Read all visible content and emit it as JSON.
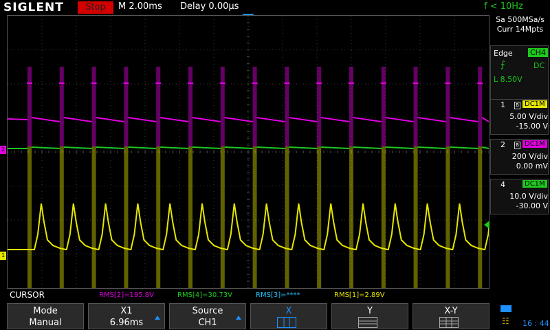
{
  "header": {
    "brand": "SIGLENT",
    "run_state": "Stop",
    "timebase": "M 2.00ms",
    "delay": "Delay 0.00μs",
    "frequency": "f < 10Hz"
  },
  "acquisition": {
    "sample_rate": "Sa 500MSa/s",
    "memory": "Curr 14Mpts"
  },
  "trigger": {
    "type": "Edge",
    "source": "CH4",
    "slope_icon": "rising-edge-icon",
    "coupling": "DC",
    "level": "L  8.50V"
  },
  "channels": [
    {
      "num": "1",
      "coupling": "DC1M",
      "vdiv": "5.00 V/div",
      "offset": "-15.00 V",
      "color": "#e6e600"
    },
    {
      "num": "2",
      "coupling": "DC1M",
      "vdiv": "200 V/div",
      "offset": "0.00 mV",
      "color": "#e000e0"
    },
    {
      "num": "4",
      "coupling": "DC1M",
      "vdiv": "10.0 V/div",
      "offset": "-30.00 V",
      "color": "#1ec81e"
    }
  ],
  "measurements": {
    "mode_label": "CURSOR",
    "items": [
      {
        "text": "RMS[2]=195.8V",
        "color": "#e000e0"
      },
      {
        "text": "RMS[4]=30.73V",
        "color": "#1ec81e"
      },
      {
        "text": "RMS[3]=****",
        "color": "#1ec8ff"
      },
      {
        "text": "RMS[1]=2.89V",
        "color": "#e6e600"
      }
    ]
  },
  "softkeys": {
    "mode": {
      "label": "Mode",
      "value": "Manual"
    },
    "x1": {
      "label": "X1",
      "value": "6.96ms"
    },
    "source": {
      "label": "Source",
      "value": "CH1"
    },
    "x": {
      "label": "X"
    },
    "y": {
      "label": "Y"
    },
    "xy": {
      "label": "X-Y"
    }
  },
  "status": {
    "clock": "16 : 44"
  }
}
